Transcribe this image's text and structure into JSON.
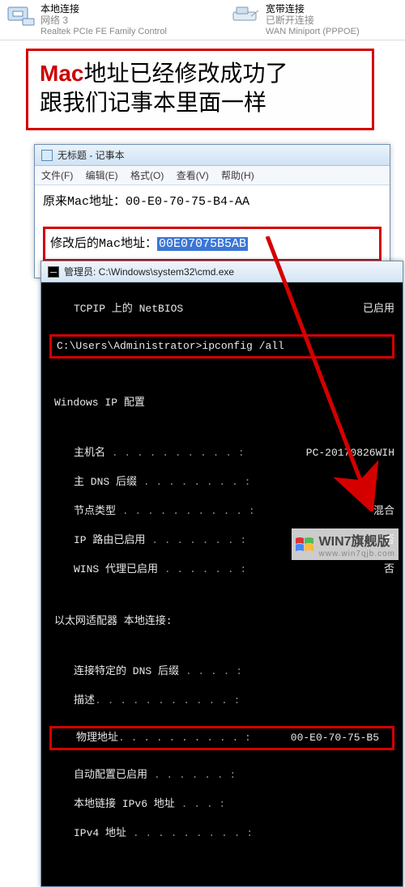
{
  "top": {
    "local": {
      "title": "本地连接",
      "sub": "网络 3",
      "adapter": "Realtek PCIe FE Family Control"
    },
    "wan": {
      "title": "宽带连接",
      "sub": "已断开连接",
      "adapter": "WAN Miniport (PPPOE)"
    }
  },
  "annotation": {
    "prefix": "Mac",
    "line1_rest": "地址已经修改成功了",
    "line2": "跟我们记事本里面一样"
  },
  "notepad": {
    "title": "无标题 - 记事本",
    "menu": {
      "file": "文件(F)",
      "edit": "编辑(E)",
      "format": "格式(O)",
      "view": "查看(V)",
      "help": "帮助(H)"
    },
    "line1_label": "原来Mac地址：",
    "line1_value": "00-E0-70-75-B4-AA",
    "line2_label": "修改后的Mac地址：",
    "line2_value": "00E07075B5AB"
  },
  "cmd": {
    "title": "管理员: C:\\Windows\\system32\\cmd.exe",
    "netbios_label": "TCPIP 上的 NetBIOS",
    "enabled": "已启用",
    "prompt": "C:\\Users\\Administrator>ipconfig /all",
    "header": "Windows IP 配置",
    "host_label": "主机名",
    "host_value": "PC-20170826WIH",
    "dns_suffix": "主 DNS 后缀",
    "nodetype_label": "节点类型",
    "nodetype_value": "混合",
    "ip_route": "IP 路由已启用",
    "wins": "WINS 代理已启用",
    "no": "否",
    "adapter_header": "以太网适配器 本地连接:",
    "conn_dns": "连接特定的 DNS 后缀",
    "desc": "描述",
    "phys_label": "物理地址",
    "phys_value": "00-E0-70-75-B5",
    "auto": "自动配置已启用",
    "linklocal": "本地链接 IPv6 地址",
    "ipv4": "IPv4 地址"
  },
  "watermark": {
    "brand": "WIN7旗舰版",
    "url": "www.win7qjb.com"
  }
}
